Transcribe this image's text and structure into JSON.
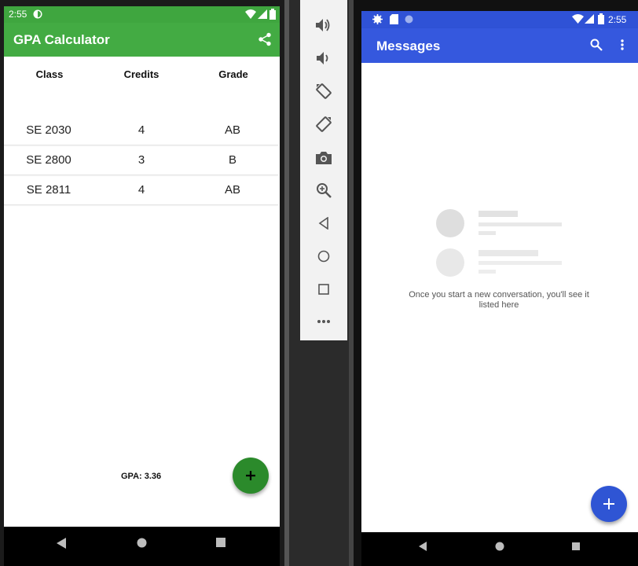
{
  "left_phone": {
    "status_bar": {
      "time": "2:55"
    },
    "app_bar": {
      "title": "GPA Calculator",
      "share_icon": "share-icon"
    },
    "table": {
      "headers": [
        "Class",
        "Credits",
        "Grade"
      ],
      "rows": [
        {
          "class": "SE 2030",
          "credits": "4",
          "grade": "AB"
        },
        {
          "class": "SE 2800",
          "credits": "3",
          "grade": "B"
        },
        {
          "class": "SE 2811",
          "credits": "4",
          "grade": "AB"
        }
      ]
    },
    "gpa_text": "GPA: 3.36",
    "fab_icon": "add-icon",
    "colors": {
      "app_bar": "#43ab43",
      "status_bar": "#3fa63f",
      "fab": "#2b8a2b"
    }
  },
  "emulator_toolbar": {
    "icons": [
      "volume-up-icon",
      "volume-down-icon",
      "rotate-left-icon",
      "rotate-right-icon",
      "camera-icon",
      "zoom-icon",
      "back-icon",
      "home-icon",
      "overview-icon",
      "more-icon"
    ]
  },
  "right_phone": {
    "status_bar": {
      "time": "2:55"
    },
    "app_bar": {
      "title": "Messages"
    },
    "empty_state": {
      "text": "Once you start a new conversation, you'll see it listed here"
    },
    "fab_icon": "add-icon",
    "colors": {
      "app_bar": "#3558de",
      "status_bar": "#2f52d6",
      "fab": "#2f55d4"
    }
  }
}
